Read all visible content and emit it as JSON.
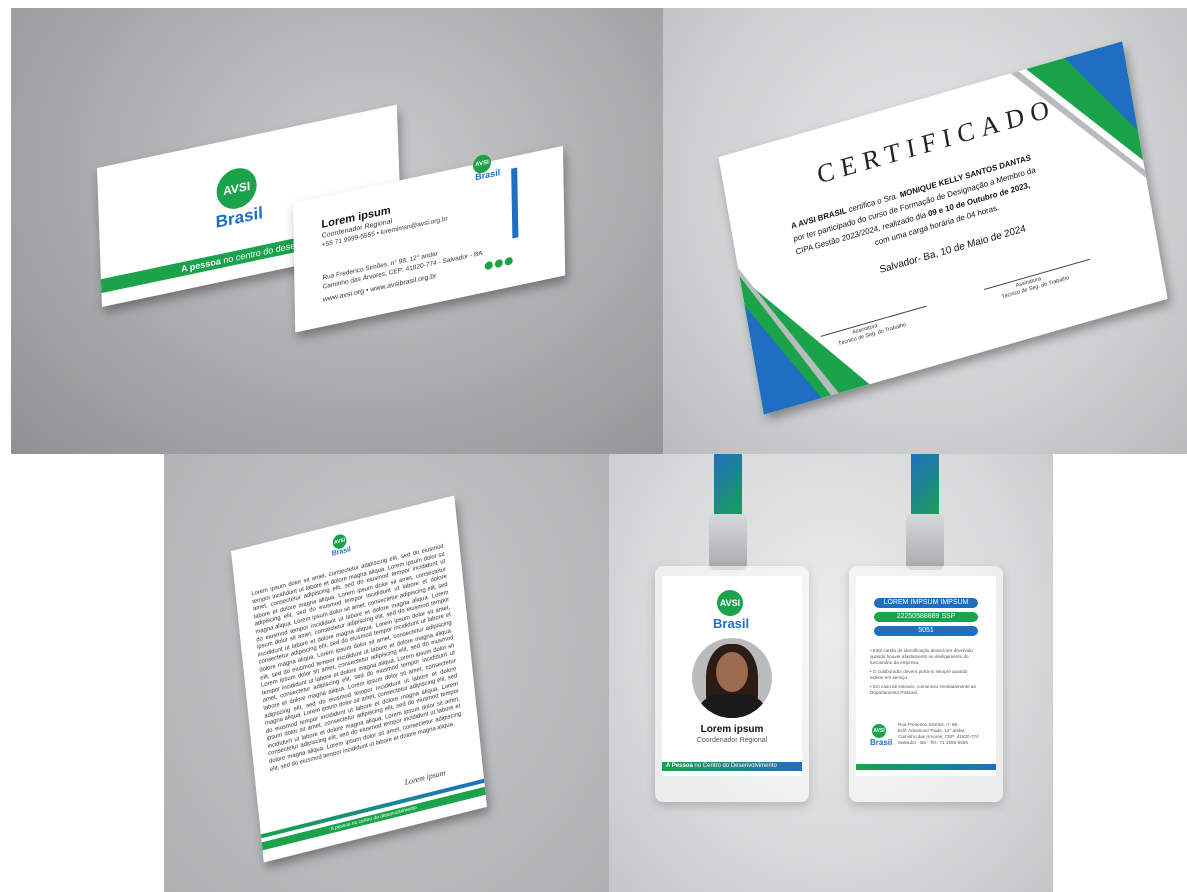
{
  "business_card": {
    "logo_text": "AVSI",
    "brand": "Brasil",
    "tagline_bold": "A pessoa",
    "tagline_rest": " no centro do desenvolvimento",
    "name": "Lorem ipsum",
    "role": "Coordenador Regional",
    "phone_email": "+55 71 9999-5555  •  loremimsn@avsi.org.br",
    "address1": "Rua Frederico Simões, n° 98, 12° andar",
    "address2": "Caminho das Árvores, CEP: 41820-774 - Salvador - BA",
    "web": "www.avsi.org  •  www.avsibrasil.org.br"
  },
  "certificate": {
    "title": "CERTIFICADO",
    "line1_pre": "A AVSI BRASIL",
    "line1_mid": " certifica o Sra. ",
    "line1_name": "MONIQUE KELLY SANTOS DANTAS",
    "line2": "por ter participado do curso de Formação de Designação a Membro da",
    "line3_pre": "CIPA Gestão 2023/2024, realizado dia ",
    "line3_dates": "09 e 10  de Outubro de 2023,",
    "line4": "com uma carga horária de 04 horas.",
    "place_date": "Salvador- Ba, 10 de Maio de 2024",
    "sig_label": "Assinatura",
    "sig_role": "Técnico de Seg. do Trabalho"
  },
  "letterhead": {
    "logo_text": "AVSI",
    "brand": "Brasil",
    "body_line": "Lorem ipsum dolor sit amet, consectetur adipiscing elit, sed do eiusmod tempor incididunt ut labore et dolore magna aliqua.",
    "signature": "Lorem ipsum",
    "footer_tagline": "A pessoa no centro do desenvolvimento"
  },
  "badge": {
    "logo_text": "AVSI",
    "brand": "Brasil",
    "name": "Lorem ipsum",
    "role": "Coordenador Regional",
    "tagline_bold": "A Pessoa",
    "tagline_rest": " no Centro do Desenvolvimento",
    "back_field1": "LOREM IMPSUM IMPSUM",
    "back_field2": "22250588889 SSP",
    "back_field3": "5051",
    "rule1": "• Este cartão de identificação deverá ser devolvido quando houver afastamento ou desligamento do funcionário da empresa.",
    "rule2": "• O colaborador deverá portá-lo sempre quando estiver em serviço.",
    "rule3": "• Em caso de extravio, comunicar imediatamente ao Departamento Pessoal.",
    "addr1": "Rua Frederico Simões, n° 98,",
    "addr2": "Edif. Advanced Trade, 12° andar,",
    "addr3": "Caminho das Árvores, CEP: 41820-774",
    "addr4": "Salvador - Ba - Tel.: 71 3555-5555"
  },
  "colors": {
    "green": "#1aa34a",
    "blue": "#1e6fc2"
  }
}
